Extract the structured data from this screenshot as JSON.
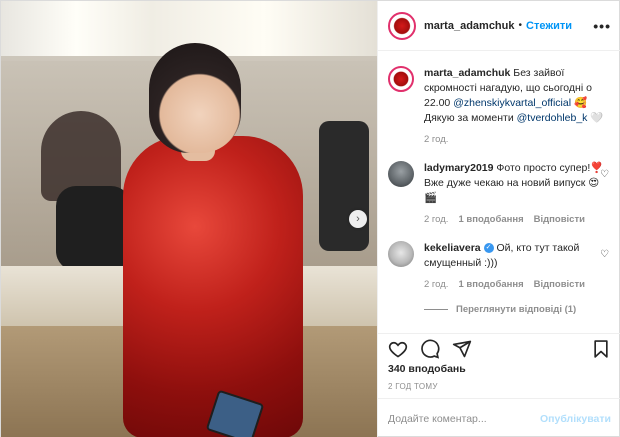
{
  "post": {
    "author": "marta_adamchuk",
    "follow_label": "Стежити",
    "more_icon": "more-horizontal-icon",
    "dot": "•"
  },
  "caption": {
    "user": "marta_adamchuk",
    "text_before": "Без зайвої скромності нагадую, що сьогодні о 22.00 ",
    "mention1": "@zhenskiykvartal_official",
    "text_mid": " 🥰 Дякую за моменти ",
    "mention2": "@tverdohleb_k",
    "text_after": " 🤍",
    "time": "2 год."
  },
  "comments": [
    {
      "user": "ladymary2019",
      "text": "Фото просто супер!❣️ Вже дуже чекаю на новий випуск 😍🎬",
      "time": "2 год.",
      "likes": "1 вподобання",
      "reply": "Відповісти"
    },
    {
      "user": "kekeliavera",
      "verified": "✓",
      "text": "Ой, кто тут такой смущенный :)))",
      "time": "2 год.",
      "likes": "1 вподобання",
      "reply": "Відповісти",
      "view_replies": "Переглянути відповіді (1)"
    }
  ],
  "actions": {
    "like_icon": "heart-icon",
    "comment_icon": "comment-icon",
    "share_icon": "share-icon",
    "save_icon": "bookmark-icon"
  },
  "likes_count": "340 вподобань",
  "post_time": "2 ГОД ТОМУ",
  "add_comment": {
    "placeholder": "Додайте коментар...",
    "publish_label": "Опублікувати"
  },
  "colors": {
    "accent": "#0095f6",
    "publish_disabled": "#b2dffc",
    "dress": "#c0211b"
  }
}
